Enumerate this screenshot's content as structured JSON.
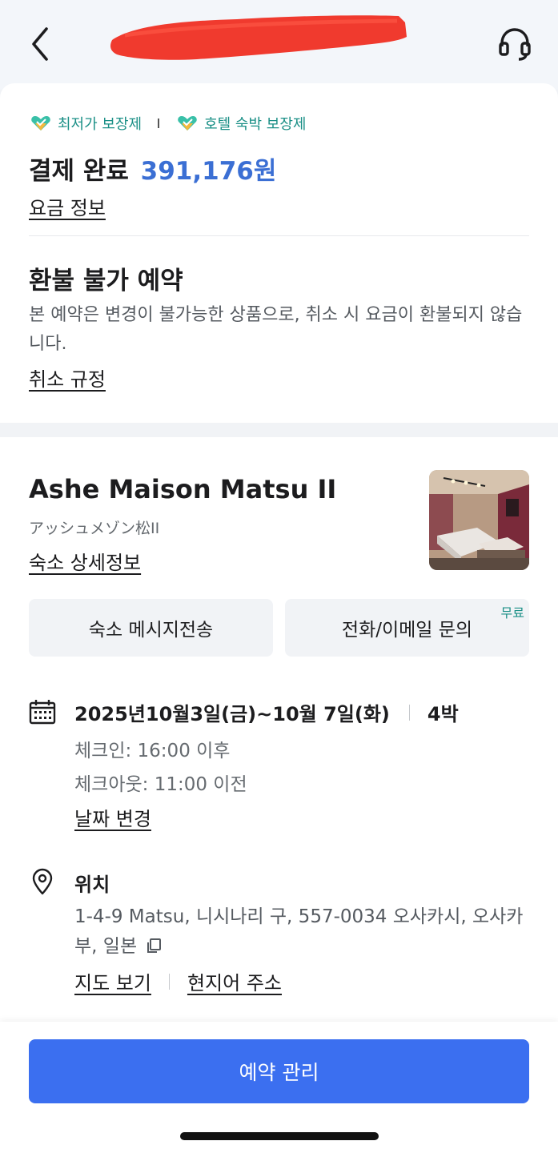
{
  "header": {
    "back_icon": "chevron-left-icon",
    "support_icon": "headset-icon",
    "redaction_color": "#f03a2e"
  },
  "payment": {
    "badges": [
      "최저가 보장제",
      "호텔 숙박 보장제"
    ],
    "badge_icon": "heart-badge-icon",
    "badge_color": "#1a8f86",
    "status_label": "결제 완료",
    "amount": "391,176원",
    "amount_color": "#3b6fd4",
    "fare_info_link": "요금 정보"
  },
  "refund": {
    "title": "환불 불가 예약",
    "description": "본 예약은 변경이 불가능한 상품으로, 취소 시 요금이 환불되지 않습니다.",
    "policy_link": "취소 규정"
  },
  "hotel": {
    "name": "Ashe Maison Matsu II",
    "native_name": "アッシュメゾン松II",
    "detail_link": "숙소 상세정보",
    "message_button": "숙소 메시지전송",
    "contact_button": "전화/이메일 문의",
    "contact_badge": "무료"
  },
  "stay": {
    "dates": "2025년10월3일(금)~10월 7일(화)",
    "nights": "4박",
    "checkin": "체크인: 16:00 이후",
    "checkout": "체크아웃: 11:00 이전",
    "change_link": "날짜 변경"
  },
  "location": {
    "title": "위치",
    "address": "1-4-9 Matsu, 니시나리 구, 557-0034 오사카시, 오사카 부, 일본",
    "map_link": "지도 보기",
    "local_address_link": "현지어 주소"
  },
  "footer": {
    "manage_button": "예약 관리",
    "button_color": "#3b6ff0"
  }
}
